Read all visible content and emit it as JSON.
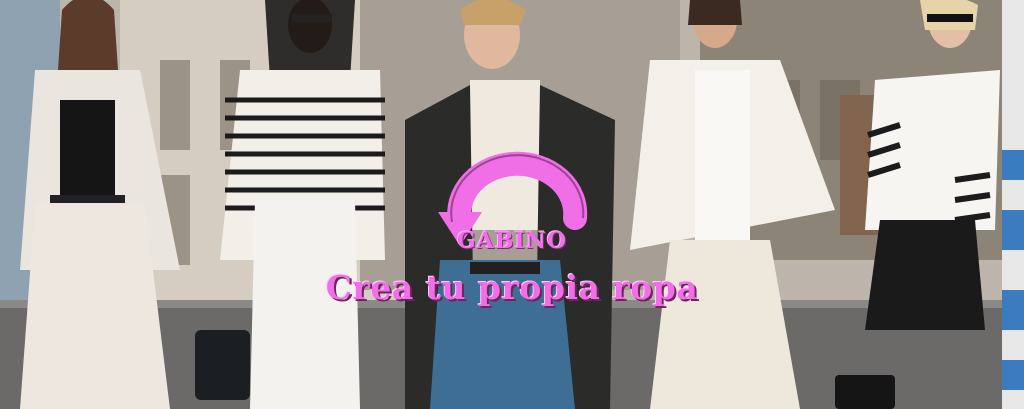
{
  "hero": {
    "brand": "GABINO",
    "tagline": "Crea tu propia ropa"
  },
  "colors": {
    "accent": "#f06ee6",
    "street": "#6c6a68",
    "building": "#c9c2b8"
  },
  "icons": {
    "logo": "circular-arrow-logo"
  }
}
